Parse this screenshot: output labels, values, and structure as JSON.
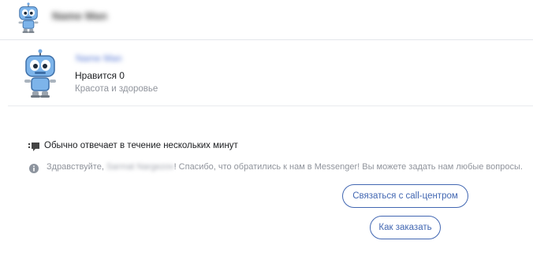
{
  "header": {
    "page_name": "Name Man"
  },
  "page_card": {
    "page_name": "Name Man",
    "likes_text": "Нравится 0",
    "category": "Красота и здоровье"
  },
  "messenger": {
    "response_time": "Обычно отвечает в течение нескольких минут",
    "greeting_prefix": "Здравствуйте,",
    "greeting_user": "Sarmat Nargezov",
    "greeting_suffix": "! Спасибо, что обратились к нам в Messenger! Вы можете задать нам любые вопросы.",
    "buttons": {
      "call_center": "Связаться с call-центром",
      "order": "Как заказать"
    }
  },
  "colors": {
    "accent": "#4267b2",
    "muted_text": "#90949c",
    "divider": "#e4e6eb",
    "robot_body": "#6fa6e0"
  },
  "icons": {
    "avatar": "robot-mascot",
    "response_time": "speech-bubble-icon",
    "greeting": "info-icon"
  }
}
